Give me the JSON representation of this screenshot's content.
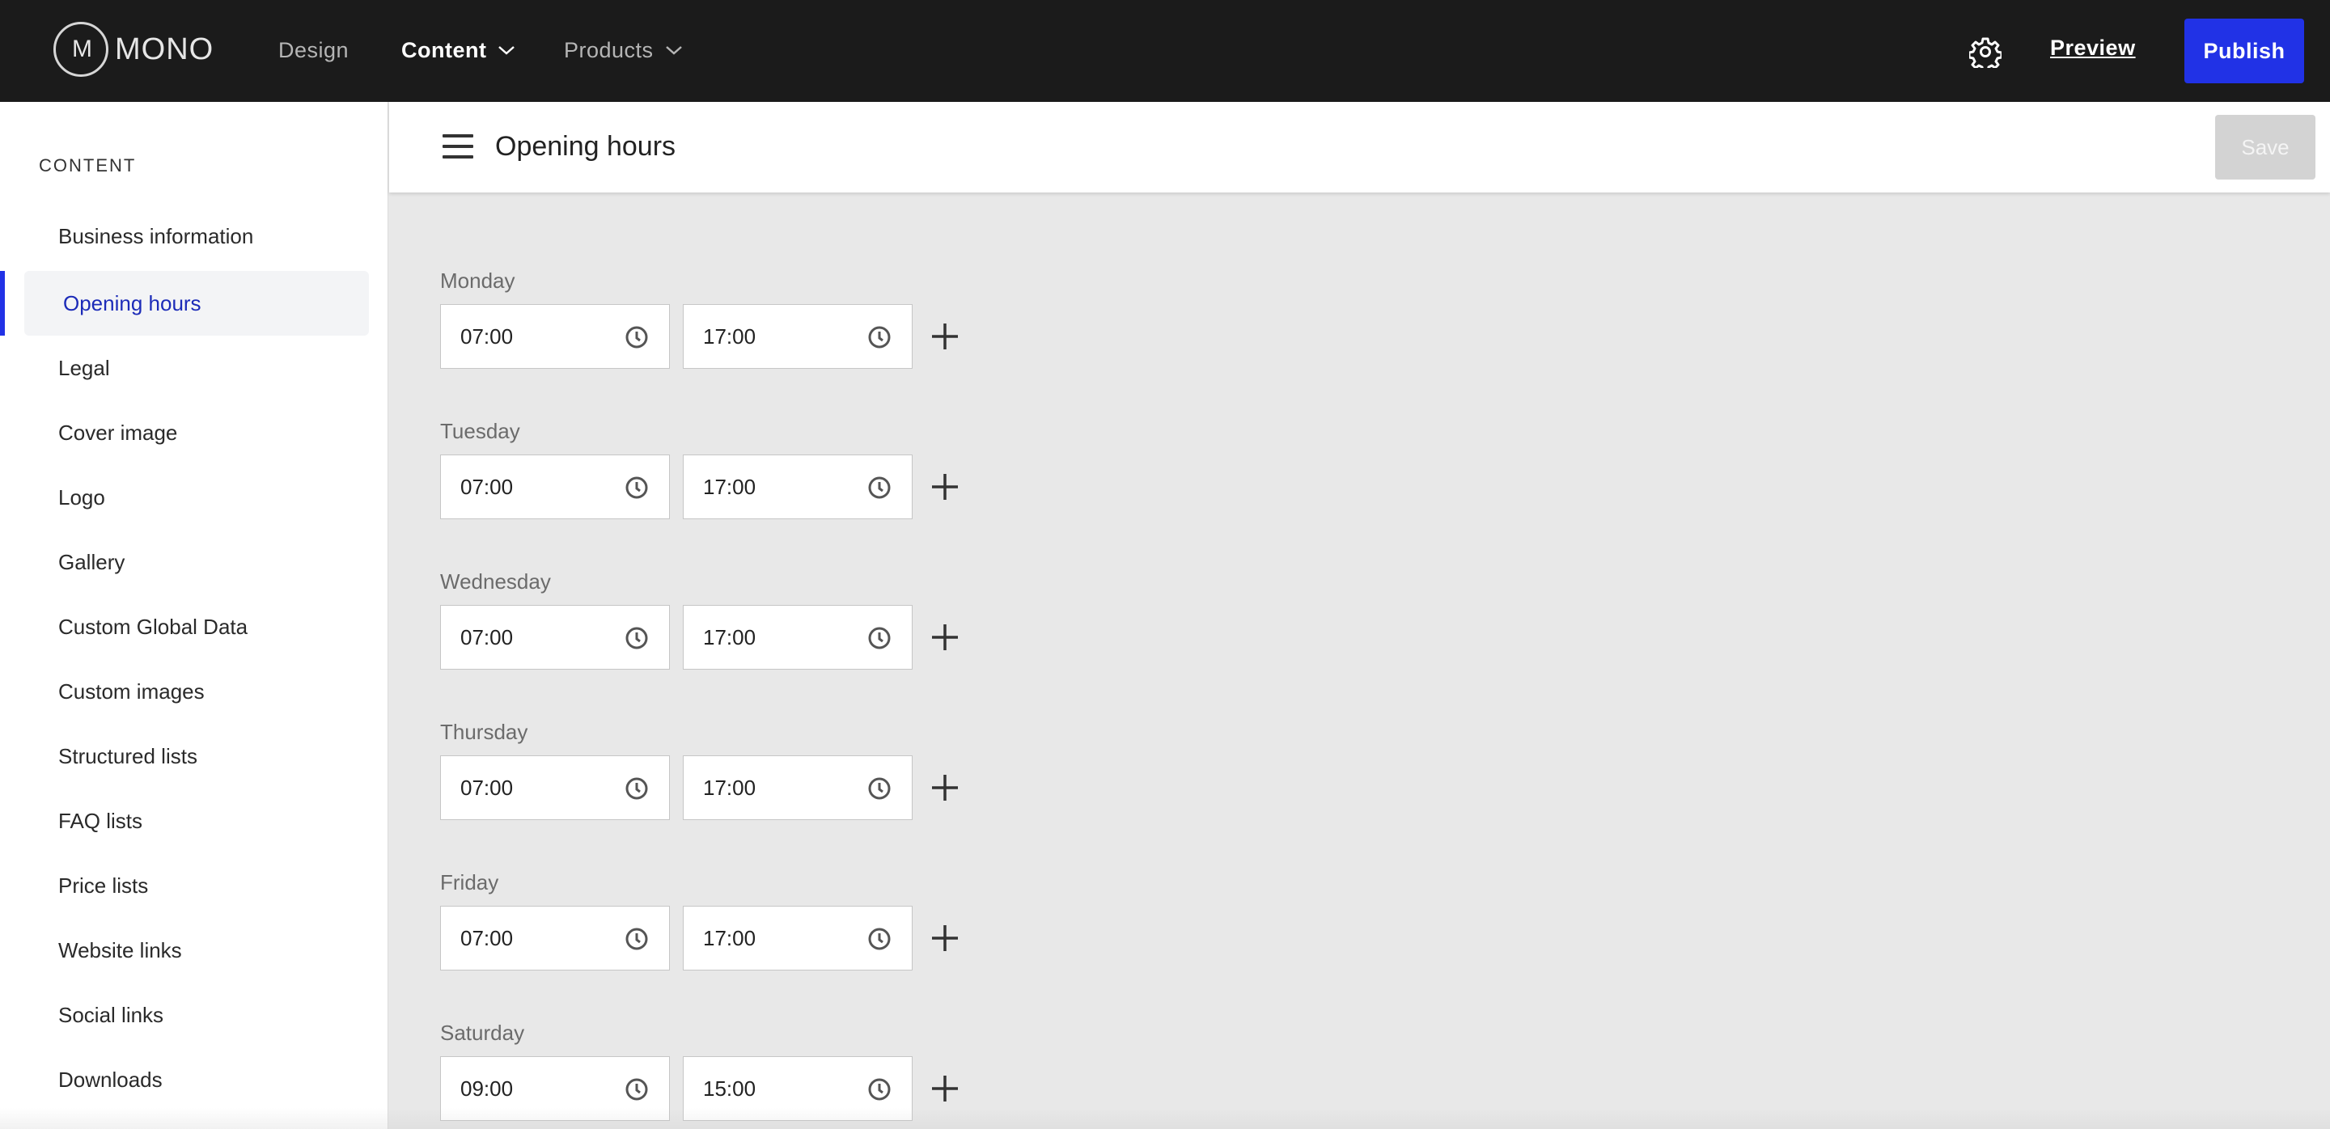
{
  "topbar": {
    "logo_mark": "M",
    "logo_text": "MONO",
    "nav": [
      {
        "label": "Design"
      },
      {
        "label": "Content"
      },
      {
        "label": "Products"
      }
    ],
    "preview_label": "Preview",
    "publish_label": "Publish"
  },
  "sidebar": {
    "heading": "CONTENT",
    "items": [
      {
        "label": "Business information"
      },
      {
        "label": "Opening hours"
      },
      {
        "label": "Legal"
      },
      {
        "label": "Cover image"
      },
      {
        "label": "Logo"
      },
      {
        "label": "Gallery"
      },
      {
        "label": "Custom Global Data"
      },
      {
        "label": "Custom images"
      },
      {
        "label": "Structured lists"
      },
      {
        "label": "FAQ lists"
      },
      {
        "label": "Price lists"
      },
      {
        "label": "Website links"
      },
      {
        "label": "Social links"
      },
      {
        "label": "Downloads"
      }
    ]
  },
  "header": {
    "title": "Opening hours",
    "save_label": "Save"
  },
  "days": [
    {
      "name": "Monday",
      "open": "07:00",
      "close": "17:00"
    },
    {
      "name": "Tuesday",
      "open": "07:00",
      "close": "17:00"
    },
    {
      "name": "Wednesday",
      "open": "07:00",
      "close": "17:00"
    },
    {
      "name": "Thursday",
      "open": "07:00",
      "close": "17:00"
    },
    {
      "name": "Friday",
      "open": "07:00",
      "close": "17:00"
    },
    {
      "name": "Saturday",
      "open": "09:00",
      "close": "15:00"
    }
  ],
  "colors": {
    "accent": "#2132e6",
    "topbar": "#1b1b1b",
    "content_bg": "#e8e8e8"
  }
}
